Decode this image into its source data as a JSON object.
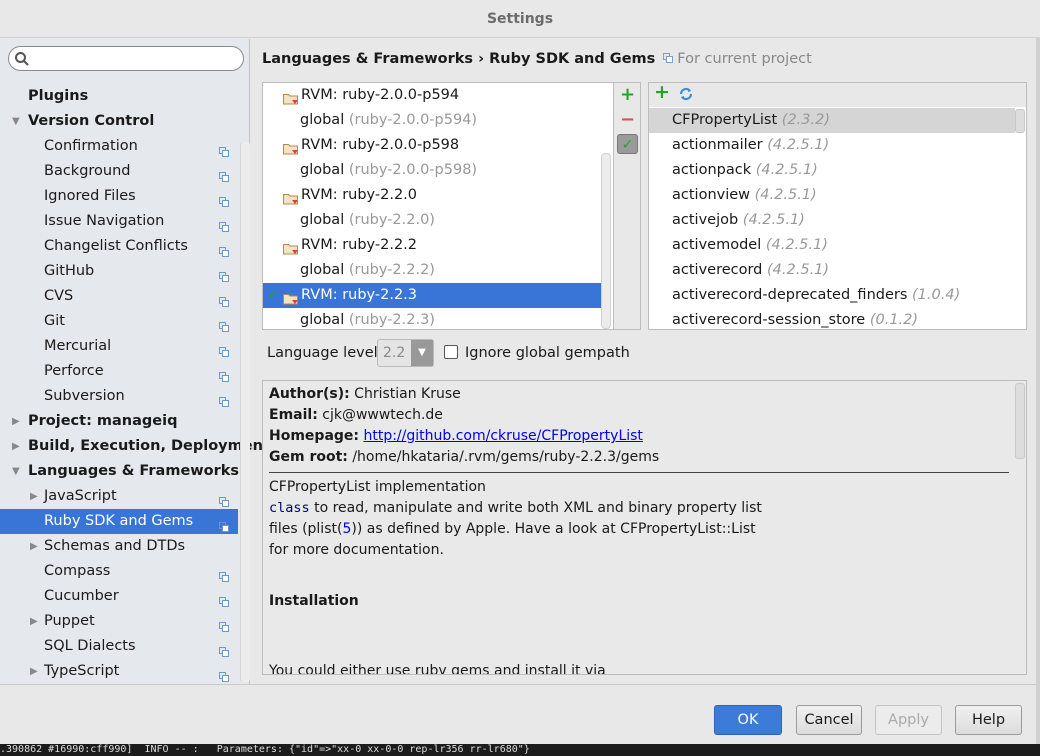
{
  "window": {
    "title": "Settings"
  },
  "search": {
    "placeholder": ""
  },
  "sidebar": {
    "items": [
      {
        "label": "Plugins",
        "level": 0,
        "bold": true,
        "arrow": "",
        "copy": false
      },
      {
        "label": "Version Control",
        "level": 0,
        "bold": true,
        "arrow": "expanded",
        "copy": false
      },
      {
        "label": "Confirmation",
        "level": 1,
        "arrow": "",
        "copy": true
      },
      {
        "label": "Background",
        "level": 1,
        "arrow": "",
        "copy": true
      },
      {
        "label": "Ignored Files",
        "level": 1,
        "arrow": "",
        "copy": true
      },
      {
        "label": "Issue Navigation",
        "level": 1,
        "arrow": "",
        "copy": true
      },
      {
        "label": "Changelist Conflicts",
        "level": 1,
        "arrow": "",
        "copy": true
      },
      {
        "label": "GitHub",
        "level": 1,
        "arrow": "",
        "copy": true
      },
      {
        "label": "CVS",
        "level": 1,
        "arrow": "",
        "copy": true
      },
      {
        "label": "Git",
        "level": 1,
        "arrow": "",
        "copy": true
      },
      {
        "label": "Mercurial",
        "level": 1,
        "arrow": "",
        "copy": true
      },
      {
        "label": "Perforce",
        "level": 1,
        "arrow": "",
        "copy": true
      },
      {
        "label": "Subversion",
        "level": 1,
        "arrow": "",
        "copy": true
      },
      {
        "label": "Project: manageiq",
        "level": 0,
        "bold": true,
        "arrow": "collapsed",
        "copy": false
      },
      {
        "label": "Build, Execution, Deployment",
        "level": 0,
        "bold": true,
        "arrow": "collapsed",
        "copy": false
      },
      {
        "label": "Languages & Frameworks",
        "level": 0,
        "bold": true,
        "arrow": "expanded",
        "copy": false
      },
      {
        "label": "JavaScript",
        "level": 1,
        "arrow": "collapsed",
        "copy": true
      },
      {
        "label": "Ruby SDK and Gems",
        "level": 1,
        "arrow": "",
        "copy": true,
        "selected": true
      },
      {
        "label": "Schemas and DTDs",
        "level": 1,
        "arrow": "collapsed",
        "copy": false
      },
      {
        "label": "Compass",
        "level": 1,
        "arrow": "",
        "copy": true
      },
      {
        "label": "Cucumber",
        "level": 1,
        "arrow": "",
        "copy": true
      },
      {
        "label": "Puppet",
        "level": 1,
        "arrow": "collapsed",
        "copy": true
      },
      {
        "label": "SQL Dialects",
        "level": 1,
        "arrow": "",
        "copy": true
      },
      {
        "label": "TypeScript",
        "level": 1,
        "arrow": "collapsed",
        "copy": true
      }
    ]
  },
  "breadcrumb": {
    "path": "Languages & Frameworks › Ruby SDK and Gems",
    "hint": "For current project"
  },
  "sdks": [
    {
      "name": "RVM: ruby-2.0.0-p594",
      "type": "sdk"
    },
    {
      "name": "global",
      "version": "(ruby-2.0.0-p594)",
      "type": "gemset"
    },
    {
      "name": "RVM: ruby-2.0.0-p598",
      "type": "sdk"
    },
    {
      "name": "global",
      "version": "(ruby-2.0.0-p598)",
      "type": "gemset"
    },
    {
      "name": "RVM: ruby-2.2.0",
      "type": "sdk"
    },
    {
      "name": "global",
      "version": "(ruby-2.2.0)",
      "type": "gemset"
    },
    {
      "name": "RVM: ruby-2.2.2",
      "type": "sdk"
    },
    {
      "name": "global",
      "version": "(ruby-2.2.2)",
      "type": "gemset"
    },
    {
      "name": "RVM: ruby-2.2.3",
      "type": "sdk",
      "selected": true,
      "checked": true
    },
    {
      "name": "global",
      "version": "(ruby-2.2.3)",
      "type": "gemset"
    }
  ],
  "sdk_tools": {
    "add": "+",
    "remove": "−",
    "check": "✓"
  },
  "gems": [
    {
      "name": "CFPropertyList",
      "version": "(2.3.2)",
      "selected": true
    },
    {
      "name": "actionmailer",
      "version": "(4.2.5.1)"
    },
    {
      "name": "actionpack",
      "version": "(4.2.5.1)"
    },
    {
      "name": "actionview",
      "version": "(4.2.5.1)"
    },
    {
      "name": "activejob",
      "version": "(4.2.5.1)"
    },
    {
      "name": "activemodel",
      "version": "(4.2.5.1)"
    },
    {
      "name": "activerecord",
      "version": "(4.2.5.1)"
    },
    {
      "name": "activerecord-deprecated_finders",
      "version": "(1.0.4)"
    },
    {
      "name": "activerecord-session_store",
      "version": "(0.1.2)"
    }
  ],
  "gem_tools": {
    "add": "+"
  },
  "language": {
    "label": "Language level:",
    "value": "2.2",
    "ignore_label": "Ignore global gempath",
    "ignore_checked": false
  },
  "doc": {
    "author_label": "Author(s):",
    "author": "Christian Kruse",
    "email_label": "Email:",
    "email": "cjk@wwwtech.de",
    "homepage_label": "Homepage:",
    "homepage": "http://github.com/ckruse/CFPropertyList",
    "root_label": "Gem root:",
    "root": "/home/hkataria/.rvm/gems/ruby-2.2.3/gems",
    "line1": "CFPropertyList implementation",
    "line2_kw": "class",
    "line2": " to read, manipulate and write both XML and binary property list",
    "line3a": "files (plist(",
    "line3_num": "5",
    "line3b": ")) as defined by Apple. Have a look at CFPropertyList::List",
    "line4": "for more documentation.",
    "heading": "Installation",
    "line5": "You could either use ruby gems and install it via"
  },
  "buttons": {
    "ok": "OK",
    "cancel": "Cancel",
    "apply": "Apply",
    "help": "Help"
  },
  "terminal": {
    "text": ".390862 #16990:cff990]  INFO -- :   Parameters: {\"id\"=>\"xx-0 xx-0-0 rep-lr356 rr-lr680\"}"
  },
  "colors": {
    "selection": "#3875d7",
    "link": "#0000ee",
    "add": "#2ca02c",
    "remove": "#d9534f"
  }
}
